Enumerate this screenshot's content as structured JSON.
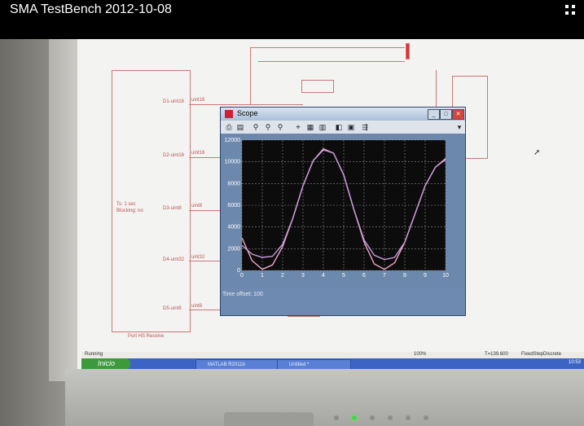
{
  "video": {
    "title": "SMA TestBench 2012-10-08"
  },
  "diagram": {
    "ports": [
      "D1-uint16",
      "D2-uint16",
      "D3-uint8",
      "D4-uint32",
      "D5-uint8"
    ],
    "signal_types": [
      "uint16",
      "uint16",
      "uint8",
      "uint32",
      "uint8"
    ],
    "block_text": [
      "Ts: 1 sec",
      "Blocking: no"
    ],
    "block_caption": "Port HS Receive"
  },
  "scope": {
    "title": "Scope",
    "time_offset_label": "Time offset:",
    "time_offset_value": "100",
    "chart_data": {
      "type": "line",
      "title": "",
      "xlabel": "",
      "ylabel": "",
      "xlim": [
        0,
        10
      ],
      "ylim": [
        0,
        12000
      ],
      "x_ticks": [
        "0",
        "1",
        "2",
        "3",
        "4",
        "5",
        "6",
        "7",
        "8",
        "9",
        "10"
      ],
      "y_ticks": [
        "0",
        "2000",
        "4000",
        "6000",
        "8000",
        "10000",
        "12000"
      ],
      "grid": true,
      "series": [
        {
          "color": "#f4a6c9",
          "x": [
            0,
            0.5,
            1,
            1.5,
            2,
            2.5,
            3,
            3.5,
            4,
            4.5,
            5,
            5.5,
            6,
            6.5,
            7,
            7.5,
            8,
            8.5,
            9,
            9.5,
            10
          ],
          "y": [
            3000,
            900,
            100,
            500,
            2200,
            4800,
            7800,
            10100,
            11200,
            10800,
            8800,
            5600,
            2600,
            600,
            100,
            700,
            2600,
            5200,
            7800,
            9500,
            10300
          ]
        },
        {
          "color": "#c79bd8",
          "x": [
            0,
            0.5,
            1,
            1.5,
            2,
            2.5,
            3,
            3.5,
            4,
            4.5,
            5,
            5.5,
            6,
            6.5,
            7,
            7.5,
            8,
            8.5,
            9,
            9.5,
            10
          ],
          "y": [
            2300,
            1500,
            1200,
            1300,
            2400,
            4800,
            7800,
            10100,
            11100,
            10800,
            8800,
            5600,
            2800,
            1400,
            1000,
            1200,
            2600,
            5200,
            7800,
            9500,
            10200
          ]
        }
      ]
    }
  },
  "status": {
    "running": "Running",
    "progress": "100%",
    "time": "T=139.600",
    "solver": "FixedStepDiscrete"
  },
  "taskbar": {
    "start_label": "Inicio",
    "items": [
      "MATLAB R2011b",
      "Untitled *"
    ],
    "clock": "10:53"
  },
  "colors": {
    "plot_bg": "#0c0c0c",
    "grid": "#8a8a8a",
    "diagram": "#c77"
  }
}
